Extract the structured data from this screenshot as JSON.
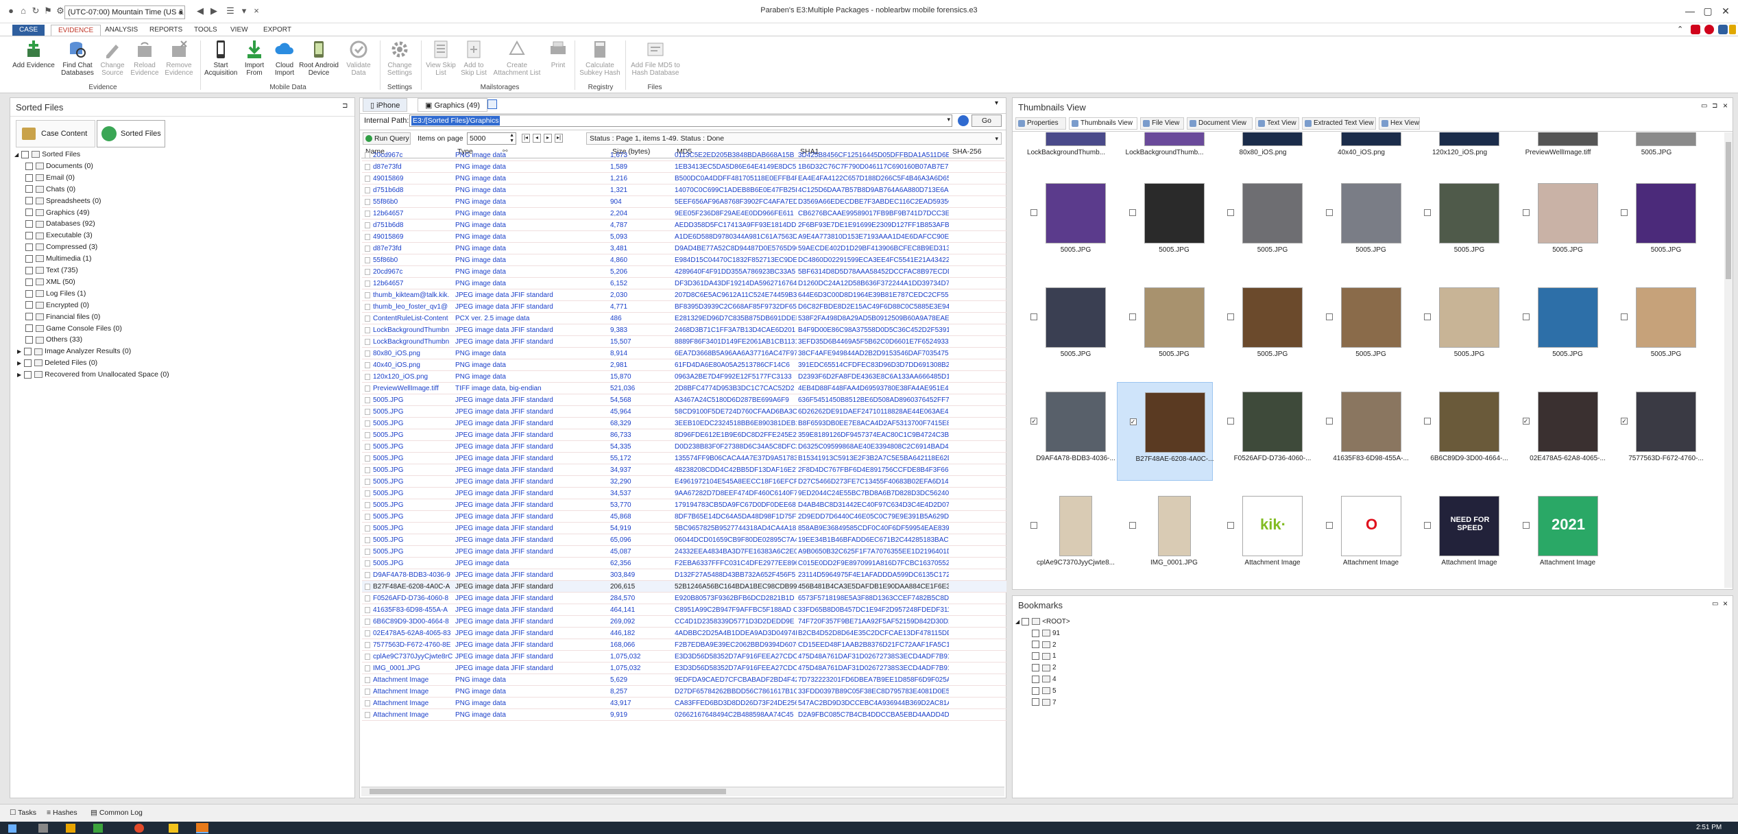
{
  "window": {
    "title": "Paraben's E3:Multiple Packages - noblearbw mobile forensics.e3",
    "timezone": "(UTC-07:00) Mountain Time (US & ...",
    "controls": [
      "—",
      "▢",
      "✕"
    ]
  },
  "ribbon_tabs": [
    "CASE",
    "EVIDENCE",
    "ANALYSIS",
    "REPORTS",
    "TOOLS",
    "VIEW",
    "EXPORT"
  ],
  "ribbon": {
    "buttons": [
      {
        "label": "Add Evidence",
        "enabled": true
      },
      {
        "label": "Find Chat Databases",
        "enabled": true
      },
      {
        "label": "Change Source",
        "enabled": false
      },
      {
        "label": "Reload Evidence",
        "enabled": false
      },
      {
        "label": "Remove Evidence",
        "enabled": false
      },
      {
        "label": "Start Acquisition",
        "enabled": true
      },
      {
        "label": "Import From",
        "enabled": true
      },
      {
        "label": "Cloud Import",
        "enabled": true
      },
      {
        "label": "Root Android Device",
        "enabled": true
      },
      {
        "label": "Validate Data",
        "enabled": false
      },
      {
        "label": "Change Settings",
        "enabled": false
      },
      {
        "label": "View Skip List",
        "enabled": false
      },
      {
        "label": "Add to Skip List",
        "enabled": false
      },
      {
        "label": "Create Attachment List",
        "enabled": false
      },
      {
        "label": "Print",
        "enabled": false
      },
      {
        "label": "Calculate Subkey Hash",
        "enabled": false
      },
      {
        "label": "Add File MD5 to Hash Database",
        "enabled": false
      }
    ],
    "groups": [
      "Evidence",
      "Mobile Data",
      "Settings",
      "Mailstorages",
      "Registry",
      "Files"
    ]
  },
  "left_panel": {
    "title": "Sorted Files",
    "tabs": [
      "Case Content",
      "Sorted Files"
    ],
    "tree": [
      {
        "label": "Sorted Files",
        "level": 0
      },
      {
        "label": "Documents (0)",
        "level": 1
      },
      {
        "label": "Email (0)",
        "level": 1
      },
      {
        "label": "Chats (0)",
        "level": 1
      },
      {
        "label": "Spreadsheets (0)",
        "level": 1
      },
      {
        "label": "Graphics (49)",
        "level": 1
      },
      {
        "label": "Databases (92)",
        "level": 1
      },
      {
        "label": "Executable (3)",
        "level": 1
      },
      {
        "label": "Compressed (3)",
        "level": 1
      },
      {
        "label": "Multimedia (1)",
        "level": 1
      },
      {
        "label": "Text (735)",
        "level": 1
      },
      {
        "label": "XML (50)",
        "level": 1
      },
      {
        "label": "Log Files (1)",
        "level": 1
      },
      {
        "label": "Encrypted (0)",
        "level": 1
      },
      {
        "label": "Financial files (0)",
        "level": 1
      },
      {
        "label": "Game Console Files (0)",
        "level": 1
      },
      {
        "label": "Others (33)",
        "level": 1
      },
      {
        "label": "Image Analyzer Results (0)",
        "level": 1,
        "expandable": true
      },
      {
        "label": "Deleted Files (0)",
        "level": 1,
        "expandable": true
      },
      {
        "label": "Recovered from Unallocated Space (0)",
        "level": 1,
        "expandable": true
      }
    ]
  },
  "center": {
    "doc_tabs": [
      "iPhone",
      "Graphics (49)"
    ],
    "internal_path_label": "Internal Path:",
    "internal_path": "E3:/[Sorted Files]/Graphics",
    "go_label": "Go",
    "run_query": "Run Query",
    "items_on_page_label": "Items on page",
    "items_on_page": "5000",
    "status": "Status : Page 1, items 1-49.  Status : Done",
    "columns": [
      "Name",
      "Type",
      "Size (bytes)",
      "MD5",
      "SHA1",
      "SHA-256"
    ],
    "rows": [
      [
        "20cd967c",
        "PNG image data",
        "1,673",
        "0113C5E2ED205B3848BDAB668A15B",
        "3D425B8456CF12516445D05DFFBDA1A511D6E8"
      ],
      [
        "d87e73fd",
        "PNG image data",
        "1,589",
        "1EB3413EC5DA5D86E64E4149E8DC5",
        "1B6D32C76C7F790D046117C690160B07AB7E78"
      ],
      [
        "49015869",
        "PNG image data",
        "1,216",
        "B500DC0A4DDFF481705118E0EFFB4F",
        "EA4E4FA4122C657D188D266C5F4B46A3A6D65"
      ],
      [
        "d751b6d8",
        "PNG image data",
        "1,321",
        "14070C0C699C1ADEB8B6E0E47FB25D",
        "4C125D6DAA7B57B8D9AB764A6A880D713E6AD"
      ],
      [
        "55f86b0",
        "PNG image data",
        "904",
        "5EEF656AF96A8768F3902FC4AFA7ED",
        "D3569A66EDECDBE7F3ABDEC116C2EAD5935CD6"
      ],
      [
        "12b64657",
        "PNG image data",
        "2,204",
        "9EE05F236D8F29AE4E0DD966FE611",
        "CB6276BCAAE99589017FB9BF9B741D7DCC3E85"
      ],
      [
        "d751b6d8",
        "PNG image data",
        "4,787",
        "AEDD358D5FC17413A9FF93E1814DD",
        "2F6BF93E7DE1E91699E2309D127FF1B853AFB2"
      ],
      [
        "49015869",
        "PNG image data",
        "5,093",
        "A1DE6D588D9780344A981C61A7563D",
        "A9E4A773810D153E7193AAA1D4E6DAFCC90E98"
      ],
      [
        "d87e73fd",
        "PNG image data",
        "3,481",
        "D9AD4BE77A52C8D94487D0E5765D96",
        "59AECDE402D1D29BF413906BCFEC8B9ED31328D"
      ],
      [
        "55f86b0",
        "PNG image data",
        "4,860",
        "E984D15C04470C1832F852713EC9DEB",
        "DC4860D02291599ECA3EE4FC5541E21A4342251"
      ],
      [
        "20cd967c",
        "PNG image data",
        "5,206",
        "4289640F4F91DD355A786923BC33A5",
        "5BF6314D8D5D78AAA58452DCCFAC8B97ECDD"
      ],
      [
        "12b64657",
        "PNG image data",
        "6,152",
        "DF3D361DA43DF19214DA5962716764",
        "D1260DC24A12D58B636F372244A1DD39734D7"
      ],
      [
        "thumb_kikteam@talk.kik.",
        "JPEG image data JFIF standard",
        "2,030",
        "207D8C6E5AC9612A11C524E74459B3",
        "644E6D3C00D8D1964E39B81E787CEDC2CF552F8E"
      ],
      [
        "thumb_leo_foster_qv1@",
        "JPEG image data JFIF standard",
        "4,771",
        "BF8395D3939C2C668AF85F9732DF65",
        "D6C82FBDE8D2E15AC49F6D88C0C5885E3E94C"
      ],
      [
        "ContentRuleList-Content",
        "PCX ver. 2.5 image data",
        "486",
        "E281329ED96D7C835B875DB691DDEF",
        "538F2FA498D8A29AD5B0912509B60A9A78EAE"
      ],
      [
        "LockBackgroundThumbn",
        "JPEG image data JFIF standard",
        "9,383",
        "2468D3B71C1FF3A7B13D4CAE6D201",
        "B4F9D00E86C98A37558D0D5C36C452D2F53919"
      ],
      [
        "LockBackgroundThumbn",
        "JPEG image data JFIF standard",
        "15,507",
        "8889F86F3401D149FE2061AB1CB1131",
        "3EFD35D6B4469A5F5B62C0D6601E7F6524933A"
      ],
      [
        "80x80_iOS.png",
        "PNG image data",
        "8,914",
        "6EA7D3668B5A96AA6A37716AC47F97",
        "38CF4AFE949844AD2B2D9153546DAF70354758"
      ],
      [
        "40x40_iOS.png",
        "PNG image data",
        "2,981",
        "61FD4DA6E80A05A2513786CF14C6",
        "391EDC65514CFDFEC83D96D3D7DD691308B285"
      ],
      [
        "120x120_iOS.png",
        "PNG image data",
        "15,870",
        "0963A2BE7D4F992E12F5177FC3133",
        "D2393F6D2FA8FDE4363E8C6A133AA666485D1"
      ],
      [
        "PreviewWellImage.tiff",
        "TIFF image data, big-endian",
        "521,036",
        "2D8BFC4774D953B3DC1C7CAC52D2",
        "4EB4D88F448FAA4D69593780E38FA4AE951E4C"
      ],
      [
        "5005.JPG",
        "JPEG image data JFIF standard",
        "54,568",
        "A3467A24C5180D6D287BE699A6F9",
        "636F5451450B8512BE6D508AD8960376452FF7"
      ],
      [
        "5005.JPG",
        "JPEG image data JFIF standard",
        "45,964",
        "58CD9100F5DE724D760CFAAD6BA3C6",
        "6D26262DE91DAEF24710118828AE44E063AE429"
      ],
      [
        "5005.JPG",
        "JPEG image data JFIF standard",
        "68,329",
        "3EEB10EDC2324518BB6E890381DEB1B",
        "B8F6593DB0EE7E8ACA4D2AF5313700F7415E82"
      ],
      [
        "5005.JPG",
        "JPEG image data JFIF standard",
        "86,733",
        "8D96FDE612E1B9E6DC8D2FFE245E2B",
        "359E8189126DF9457374EAC80C1C9B4724C3B6"
      ],
      [
        "5005.JPG",
        "JPEG image data JFIF standard",
        "54,335",
        "D0D238B83F0F27388D6C34A5C8DFC2",
        "D6325C09599868AE40E3394808C2C6914BAD4A47"
      ],
      [
        "5005.JPG",
        "JPEG image data JFIF standard",
        "55,172",
        "135574FF9B06CACA4A7E37D9A51783",
        "B15341913C5913E2F3B2A7C5E5BA642118E62D2D9"
      ],
      [
        "5005.JPG",
        "JPEG image data JFIF standard",
        "34,937",
        "48238208CDD4C42BB5DF13DAF16E27",
        "2F8D4DC767FBF6D4E891756CCFDE8B4F3F66E4D6"
      ],
      [
        "5005.JPG",
        "JPEG image data JFIF standard",
        "32,290",
        "E4961972104E545A8EECC18F16EFCF4",
        "D27C5466D273FE7C13455F40683B02EFA6D14"
      ],
      [
        "5005.JPG",
        "JPEG image data JFIF standard",
        "34,537",
        "9AA67282D7D8EEF474DF460C6140F7",
        "9ED2044C24E55BC7BD8A6B7D828D3DC562406"
      ],
      [
        "5005.JPG",
        "JPEG image data JFIF standard",
        "53,770",
        "179194783CB5DA9FC67D0DF0DEE68",
        "D4AB4BC8D31442EC40F97C634D3C4E4D2D079"
      ],
      [
        "5005.JPG",
        "JPEG image data JFIF standard",
        "45,868",
        "8DF7B65E14DC64A5DA48D98F1D75F76",
        "2D9EDD7D6440C46E05C0C79E9E391B5A629DCD3"
      ],
      [
        "5005.JPG",
        "JPEG image data JFIF standard",
        "54,919",
        "5BC9657825B9527744318AD4CA4A18",
        "858AB9E36849585CDF0C40F6DF59954EAE83999"
      ],
      [
        "5005.JPG",
        "JPEG image data JFIF standard",
        "65,096",
        "06044DCD01659CB9F80DE02895C7A4",
        "19EE34B1B46BFADD6EC671B2C44285183BAC04"
      ],
      [
        "5005.JPG",
        "JPEG image data JFIF standard",
        "45,087",
        "24332EEA4834BA3D7FE16383A6C2E0",
        "A9B0650B32C625F1F7A7076355EE1D2196401D2"
      ],
      [
        "5005.JPG",
        "JPEG image data",
        "62,356",
        "F2EBA6337FFFC031C4DFE2977EE896D",
        "C015E0DD2F9E8970991A816D7FCBC163705524"
      ],
      [
        "D9AF4A78-BDB3-4036-9",
        "JPEG image data JFIF standard",
        "303,849",
        "D132F27A5488D43BB732A652F456F5",
        "23114D5964975F4E1AFADDDA599DC6135C172A"
      ],
      [
        "B27F48AE-6208-4A0C-A",
        "JPEG image data JFIF standard",
        "206,615",
        "52B1246A56BC164BDA1BEC98CDB99",
        "456B481B4CA3E5DAFDB1E90DAA884CE1F6E3FF"
      ],
      [
        "F0526AFD-D736-4060-8",
        "JPEG image data JFIF standard",
        "284,570",
        "E920B80573F9362BFB6DCD2821B1D",
        "6573F5718198E5A3F88D1363CCEF7482B5C8D"
      ],
      [
        "41635F83-6D98-455A-A",
        "JPEG image data JFIF standard",
        "464,141",
        "C8951A99C2B947F9AFFBC5F188AD C4",
        "33FD65B8D0B457DC1E94F2D957248FDEDF31125"
      ],
      [
        "6B6C89D9-3D00-4664-8",
        "JPEG image data JFIF standard",
        "269,092",
        "CC4D1D2358339D5771D3D2DEDD9E",
        "74F720F357F9BE71AA92F5AF52159D842D30D2"
      ],
      [
        "02E478A5-62A8-4065-83",
        "JPEG image data JFIF standard",
        "446,182",
        "4ADBBC2D25A4B1DDEA9AD3D04974B",
        "B2CB4D52D8D64E35C2DCFCAE13DF478115DDB6"
      ],
      [
        "7577563D-F672-4760-8E",
        "JPEG image data JFIF standard",
        "168,066",
        "F2B7EDBA9E39EC2062BBD9394D6070",
        "CD15EED48F1AAB2B8376D21FC72AAF1FA5C1F7"
      ],
      [
        "cplAe9C7370JyyCjwte8rC",
        "JPEG image data JFIF standard",
        "1,075,032",
        "E3D3D56D58352D7AF916FEEA27CDC",
        "475D48A761DAF31D02672738S3ECD4ADF7B917"
      ],
      [
        "IMG_0001.JPG",
        "JPEG image data JFIF standard",
        "1,075,032",
        "E3D3D56D58352D7AF916FEEA27CDC",
        "475D48A761DAF31D02672738S3ECD4ADF7B917"
      ],
      [
        "Attachment Image",
        "PNG image data",
        "5,629",
        "9EDFDA9CAED7CFCBABADF2BD4F428",
        "7D732223201FD6DBEA7B9EE1D858F6D9F025AD"
      ],
      [
        "Attachment Image",
        "PNG image data",
        "8,257",
        "D27DF65784262BBDD56C7861617B1C",
        "33FDD0397B89C05F38EC8D795783E4081D0E5E2"
      ],
      [
        "Attachment Image",
        "PNG image data",
        "43,917",
        "CA83FFED6BD3D8DD26D73F24DE256C2",
        "547AC2BD9D3DCCEBC4A936944B369D2AC81A"
      ],
      [
        "Attachment Image",
        "PNG image data",
        "9,919",
        "02662167648494C2B488598AA74C45",
        "D2A9FBC085C7B4CB4DDCCBA5EBD4AADD4DAD"
      ]
    ]
  },
  "thumbnails": {
    "title": "Thumbnails View",
    "tabs": [
      "Properties",
      "Thumbnails View",
      "File View",
      "Document View",
      "Text View",
      "Extracted Text View",
      "Hex View"
    ],
    "rows": [
      [
        {
          "label": "LockBackgroundThumb...",
          "color": "#4a4a8a",
          "checked": false
        },
        {
          "label": "LockBackgroundThumb...",
          "color": "#6a4a9a",
          "checked": false
        },
        {
          "label": "80x80_iOS.png",
          "color": "#1b2c4a",
          "checked": false
        },
        {
          "label": "40x40_iOS.png",
          "color": "#1b2c4a",
          "checked": false
        },
        {
          "label": "120x120_iOS.png",
          "color": "#1b2c4a",
          "checked": false
        },
        {
          "label": "PreviewWellImage.tiff",
          "color": "#555",
          "checked": false
        },
        {
          "label": "5005.JPG",
          "color": "#8a8a8a",
          "checked": false
        }
      ],
      [
        {
          "label": "5005.JPG",
          "color": "#5b3b8c",
          "checked": false
        },
        {
          "label": "5005.JPG",
          "color": "#2a2a2a",
          "checked": false
        },
        {
          "label": "5005.JPG",
          "color": "#6e6e72",
          "checked": false
        },
        {
          "label": "5005.JPG",
          "color": "#7a7d86",
          "checked": false
        },
        {
          "label": "5005.JPG",
          "color": "#4f5a4a",
          "checked": false
        },
        {
          "label": "5005.JPG",
          "color": "#c9b2a6",
          "checked": false
        },
        {
          "label": "5005.JPG",
          "color": "#4b2a7a",
          "checked": false
        }
      ],
      [
        {
          "label": "5005.JPG",
          "color": "#3a3f52",
          "checked": false
        },
        {
          "label": "5005.JPG",
          "color": "#a8926e",
          "checked": false
        },
        {
          "label": "5005.JPG",
          "color": "#6b4a2c",
          "checked": false
        },
        {
          "label": "5005.JPG",
          "color": "#8a6b4a",
          "checked": false
        },
        {
          "label": "5005.JPG",
          "color": "#c8b496",
          "checked": false
        },
        {
          "label": "5005.JPG",
          "color": "#2d6fa8",
          "checked": false
        },
        {
          "label": "5005.JPG",
          "color": "#c6a27a",
          "checked": false
        }
      ],
      [
        {
          "label": "D9AF4A78-BDB3-4036-...",
          "color": "#58606a",
          "checked": true
        },
        {
          "label": "B27F48AE-6208-4A0C-...",
          "color": "#5a3a22",
          "checked": true
        },
        {
          "label": "F0526AFD-D736-4060-...",
          "color": "#3e4a3a",
          "checked": false
        },
        {
          "label": "41635F83-6D98-455A-...",
          "color": "#8a7660",
          "checked": false
        },
        {
          "label": "6B6C89D9-3D00-4664-...",
          "color": "#6a5a3a",
          "checked": false
        },
        {
          "label": "02E478A5-62A8-4065-...",
          "color": "#3a3030",
          "checked": true
        },
        {
          "label": "7577563D-F672-4760-...",
          "color": "#3a3a44",
          "checked": true
        }
      ],
      [
        {
          "label": "cplAe9C7370JyyCjwte8...",
          "color": "#d9cbb4",
          "checked": false
        },
        {
          "label": "IMG_0001.JPG",
          "color": "#d9cbb4",
          "checked": false
        },
        {
          "label": "Attachment Image",
          "color": "#ffffff",
          "checked": false,
          "glyph": "kik·",
          "glyph_color": "#82bc23"
        },
        {
          "label": "Attachment Image",
          "color": "#ffffff",
          "checked": false,
          "glyph": "O",
          "glyph_color": "#e0121e"
        },
        {
          "label": "Attachment Image",
          "color": "#22223a",
          "checked": false,
          "glyph": "NEED FOR SPEED",
          "glyph_color": "#ffffff"
        },
        {
          "label": "Attachment Image",
          "color": "#2aa866",
          "checked": false,
          "glyph": "2021",
          "glyph_color": "#ffffff"
        }
      ]
    ]
  },
  "bookmarks": {
    "title": "Bookmarks",
    "root": "<ROOT>",
    "items": [
      "91",
      "2",
      "1",
      "2",
      "4",
      "5",
      "7"
    ]
  },
  "statusbar": {
    "items": [
      "Tasks",
      "Hashes",
      "Common Log"
    ]
  },
  "taskbar": {
    "clock": "2:51 PM"
  }
}
